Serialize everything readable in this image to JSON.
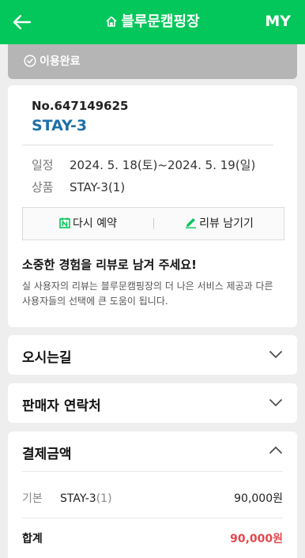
{
  "header": {
    "title": "블루문캠핑장",
    "my_label": "MY",
    "bg_color": "#03c75a"
  },
  "status": {
    "label": "이용완료"
  },
  "order": {
    "number": "No.647149625",
    "room": "STAY-3",
    "schedule_label": "일정",
    "schedule_value": "2024. 5. 18(토)~2024. 5. 19(일)",
    "product_label": "상품",
    "product_value": "STAY-3(1)"
  },
  "actions": {
    "rebook_label": "다시 예약",
    "review_label": "리뷰 남기기"
  },
  "review_prompt": {
    "title": "소중한 경험을 리뷰로 남겨 주세요!",
    "description": "실 사용자의 리뷰는 블루문캠핑장의 더 나은 서비스 제공과 다른 사용자들의 선택에 큰 도움이 됩니다."
  },
  "sections": {
    "directions": "오시는길",
    "seller_contact": "판매자 연락처",
    "payment": "결제금액"
  },
  "payment": {
    "basic_label": "기본",
    "item_name": "STAY-3",
    "item_qty": "(1)",
    "item_amount": "90,000원",
    "total_label": "합계",
    "total_amount": "90,000원",
    "total_color": "#e5484d"
  }
}
